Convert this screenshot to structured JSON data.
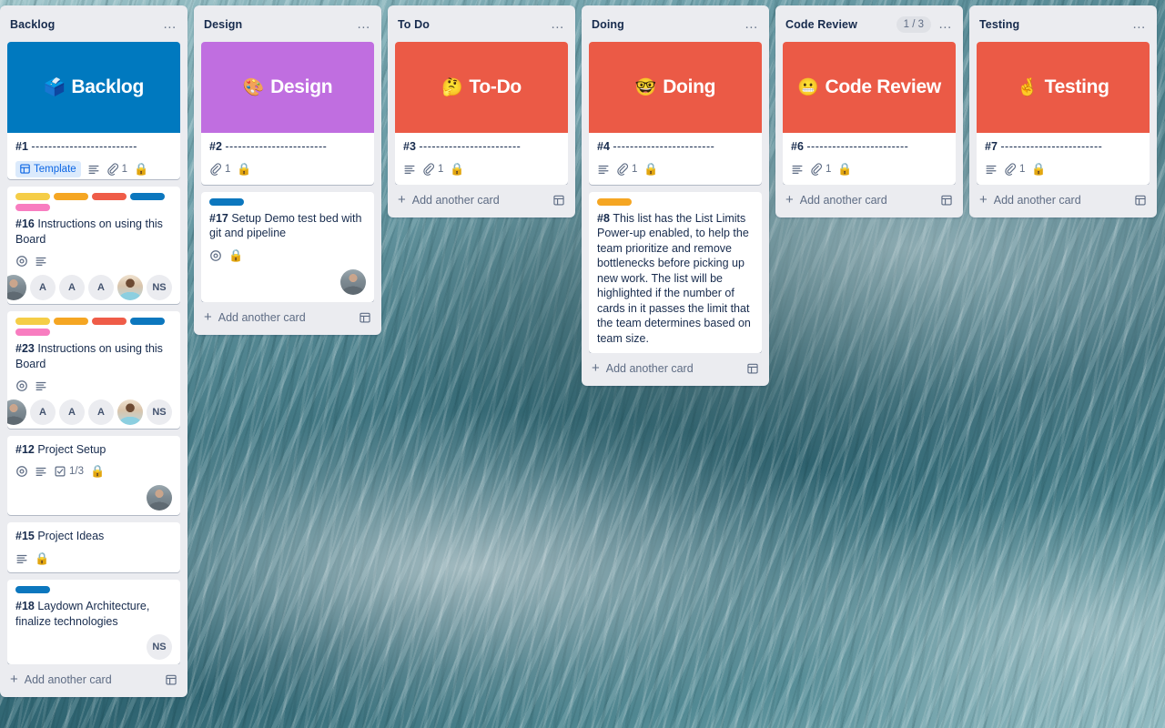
{
  "board": {
    "background_description": "ocean-wave-photo",
    "background_color": "#4e7f8a"
  },
  "icons": {
    "list_menu": "…",
    "add_plus": "+",
    "lock_emoji": "🔒"
  },
  "labels": {
    "yellow": "#f5cd47",
    "orange": "#f5a623",
    "red": "#ef5c48",
    "blue": "#0c77be",
    "pink": "#f87dc0"
  },
  "lists": [
    {
      "id": "backlog",
      "title": "Backlog",
      "limit": "",
      "menu": "…",
      "add_card_label": "Add another card",
      "cards": [
        {
          "id": "card-1",
          "cover": {
            "text": "Backlog",
            "emoji": "🗳️",
            "color": "#0079bf"
          },
          "labels": [],
          "number": "#1",
          "title": "-------------------------",
          "badges": [
            "template",
            "description",
            "attachment",
            "lock"
          ],
          "template_label": "Template",
          "attachment_count": "1",
          "members": []
        },
        {
          "id": "card-16",
          "cover": null,
          "labels": [
            "yellow",
            "orange",
            "red",
            "blue",
            "pink"
          ],
          "number": "#16",
          "title": "Instructions on using this Board",
          "badges": [
            "watch",
            "description"
          ],
          "members": [
            "photo-a",
            "A",
            "A",
            "A",
            "photo-b",
            "NS"
          ]
        },
        {
          "id": "card-23",
          "cover": null,
          "labels": [
            "yellow",
            "orange",
            "red",
            "blue",
            "pink"
          ],
          "number": "#23",
          "title": "Instructions on using this Board",
          "badges": [
            "watch",
            "description"
          ],
          "members": [
            "photo-a",
            "A",
            "A",
            "A",
            "photo-b",
            "NS"
          ]
        },
        {
          "id": "card-12",
          "cover": null,
          "labels": [],
          "number": "#12",
          "title": "Project Setup",
          "badges": [
            "watch",
            "description",
            "checklist",
            "lock"
          ],
          "checklist_count": "1/3",
          "members": [
            "photo-a"
          ]
        },
        {
          "id": "card-15",
          "cover": null,
          "labels": [],
          "number": "#15",
          "title": "Project Ideas",
          "badges": [
            "description",
            "lock"
          ],
          "members": []
        },
        {
          "id": "card-18",
          "cover": null,
          "labels": [
            "blue"
          ],
          "number": "#18",
          "title": "Laydown Architecture, finalize technologies",
          "badges": [],
          "members": [
            "NS"
          ]
        }
      ]
    },
    {
      "id": "design",
      "title": "Design",
      "limit": "",
      "menu": "…",
      "add_card_label": "Add another card",
      "cards": [
        {
          "id": "card-2",
          "cover": {
            "text": "Design",
            "emoji": "🎨",
            "color": "#c06ee0"
          },
          "labels": [],
          "number": "#2",
          "title": "------------------------",
          "badges": [
            "attachment",
            "lock"
          ],
          "attachment_count": "1",
          "members": []
        },
        {
          "id": "card-17",
          "cover": null,
          "labels": [
            "blue"
          ],
          "number": "#17",
          "title": "Setup Demo test bed with git and pipeline",
          "badges": [
            "watch",
            "lock"
          ],
          "members": [
            "photo-a"
          ]
        }
      ]
    },
    {
      "id": "todo",
      "title": "To Do",
      "limit": "",
      "menu": "…",
      "add_card_label": "Add another card",
      "cards": [
        {
          "id": "card-3",
          "cover": {
            "text": "To-Do",
            "emoji": "🤔",
            "color": "#eb5a46"
          },
          "labels": [],
          "number": "#3",
          "title": "------------------------",
          "badges": [
            "description",
            "attachment",
            "lock"
          ],
          "attachment_count": "1",
          "members": []
        }
      ]
    },
    {
      "id": "doing",
      "title": "Doing",
      "limit": "",
      "menu": "…",
      "add_card_label": "Add another card",
      "cards": [
        {
          "id": "card-4",
          "cover": {
            "text": "Doing",
            "emoji": "🤓",
            "color": "#eb5a46"
          },
          "labels": [],
          "number": "#4",
          "title": "------------------------",
          "badges": [
            "description",
            "attachment",
            "lock"
          ],
          "attachment_count": "1",
          "members": []
        },
        {
          "id": "card-8",
          "cover": null,
          "labels": [
            "orange"
          ],
          "number": "#8",
          "title": "This list has the List Limits Power-up enabled, to help the team prioritize and remove bottlenecks before picking up new work. The list will be highlighted if the number of cards in it passes the limit that the team determines based on team size.",
          "badges": [],
          "members": []
        }
      ]
    },
    {
      "id": "code-review",
      "title": "Code Review",
      "limit": "1 / 3",
      "menu": "…",
      "add_card_label": "Add another card",
      "cards": [
        {
          "id": "card-6",
          "cover": {
            "text": "Code Review",
            "emoji": "😬",
            "color": "#eb5a46"
          },
          "labels": [],
          "number": "#6",
          "title": "------------------------",
          "badges": [
            "description",
            "attachment",
            "lock"
          ],
          "attachment_count": "1",
          "members": []
        }
      ]
    },
    {
      "id": "testing",
      "title": "Testing",
      "limit": "",
      "menu": "…",
      "add_card_label": "Add another card",
      "cards": [
        {
          "id": "card-7",
          "cover": {
            "text": "Testing",
            "emoji": "🤞",
            "color": "#eb5a46"
          },
          "labels": [],
          "number": "#7",
          "title": "------------------------",
          "badges": [
            "description",
            "attachment",
            "lock"
          ],
          "attachment_count": "1",
          "members": []
        }
      ]
    }
  ]
}
